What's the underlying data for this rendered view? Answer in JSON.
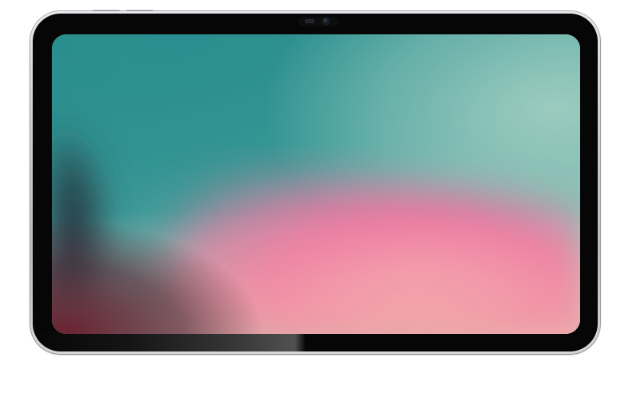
{
  "device": {
    "type": "tablet",
    "orientation": "landscape",
    "frame_color": "#cfcdd3",
    "bezel_color": "#060606"
  },
  "screen": {
    "wallpaper": "abstract-gradient",
    "colors": {
      "teal": "#2e8f8e",
      "mint": "#8cc3b8",
      "pink": "#ef6f9e",
      "peach": "#f1b8ad",
      "dark_slate": "#223a44",
      "dark_maroon": "#5b2230"
    }
  }
}
